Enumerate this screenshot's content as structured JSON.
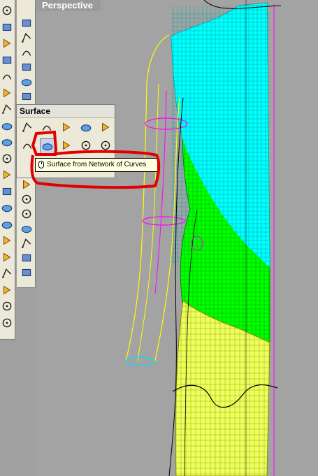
{
  "viewport": {
    "title": "Perspective",
    "background_color": "#a3a3a3",
    "colors": {
      "upper_surface": "#00ffff",
      "middle_surface": "#00ff00",
      "lower_surface": "#eaff60",
      "wire_yellow": "#ffff00",
      "wire_magenta": "#ff00ff",
      "wire_black": "#000000"
    }
  },
  "toolbars": {
    "main": {
      "icons": [
        "select-arrow-icon",
        "point-icon",
        "polyline-icon",
        "circle-icon",
        "arc-icon",
        "ellipse-icon",
        "surface-icon",
        "box-icon",
        "cylinder-icon",
        "sphere-icon",
        "fillet-icon",
        "boolean-icon",
        "move-icon",
        "transform-icon",
        "text-icon",
        "group-icon",
        "analyze-icon",
        "render-icon",
        "mirror-icon",
        "block-icon"
      ]
    },
    "secondary": {
      "icons": [
        "point-cloud-icon",
        "curve-icon",
        "control-point-icon",
        "rectangle-icon",
        "polygon-icon",
        "curve-fillet-icon",
        "offset-icon",
        "edit-points-icon",
        "join-icon",
        "explode-icon",
        "trim-icon",
        "split-icon",
        "rebuild-icon",
        "dimension-icon",
        "layer-icon",
        "osnap-icon",
        "history-icon",
        "plane-icon"
      ]
    }
  },
  "flyout": {
    "title": "Surface",
    "row1": [
      "surface-from-points-icon",
      "edge-curves-icon",
      "planar-surface-icon",
      "rectangle-surface-icon",
      "extrude-icon"
    ],
    "row2": [
      "loft-icon",
      "network-surface-icon",
      "sweep-icon",
      "revolve-icon",
      "blend-icon"
    ],
    "selected": "network-surface-icon"
  },
  "tooltip": {
    "text": "Surface from Network of Curves"
  },
  "annotation": {
    "color": "#e00000"
  }
}
